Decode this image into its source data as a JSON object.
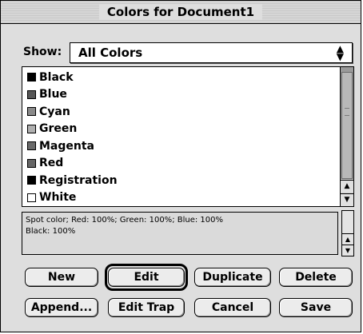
{
  "window": {
    "title": "Colors for Document1"
  },
  "show": {
    "label": "Show:",
    "selected": "All Colors"
  },
  "colors": [
    {
      "name": "Black",
      "swatch": "#000000"
    },
    {
      "name": "Blue",
      "swatch": "#555555"
    },
    {
      "name": "Cyan",
      "swatch": "#8a8a8a"
    },
    {
      "name": "Green",
      "swatch": "#b0b0b0"
    },
    {
      "name": "Magenta",
      "swatch": "#6a6a6a"
    },
    {
      "name": "Red",
      "swatch": "#666666"
    },
    {
      "name": "Registration",
      "swatch": "#000000"
    },
    {
      "name": "White",
      "swatch": "#ffffff"
    }
  ],
  "description": {
    "line1": "Spot color; Red: 100%; Green: 100%; Blue: 100%",
    "line2": "Black: 100%"
  },
  "buttons": {
    "new": "New",
    "edit": "Edit",
    "duplicate": "Duplicate",
    "delete": "Delete",
    "append": "Append...",
    "edit_trap": "Edit Trap",
    "cancel": "Cancel",
    "save": "Save"
  }
}
